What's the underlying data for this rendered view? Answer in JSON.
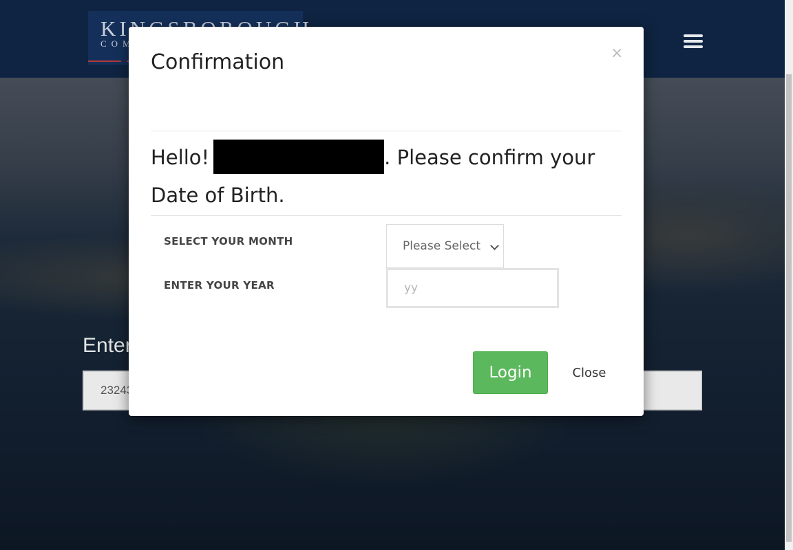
{
  "header": {
    "logo_main": "KINGSBOROUGH",
    "logo_sub": "COM",
    "menu_icon": "hamburger-menu-icon"
  },
  "background": {
    "label": "Enter",
    "input_value": "23243"
  },
  "modal": {
    "title": "Confirmation",
    "close_symbol": "×",
    "greeting": "Hello!",
    "greeting_rest": ". Please confirm your Date of Birth.",
    "month_label": "SELECT YOUR MONTH",
    "month_selected": "Please Select",
    "year_label": "ENTER YOUR YEAR",
    "year_placeholder": "yy",
    "login_label": "Login",
    "close_label": "Close"
  },
  "colors": {
    "header_bg": "#0f2442",
    "login_green": "#5cb85c"
  }
}
